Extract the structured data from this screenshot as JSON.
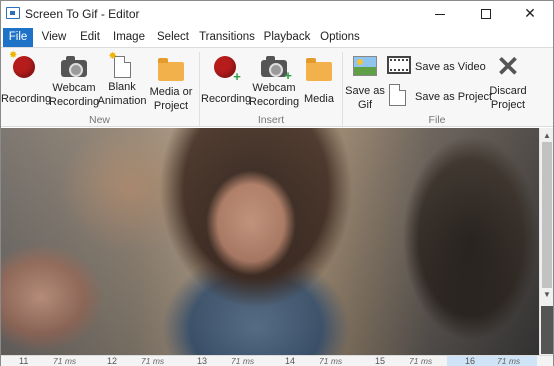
{
  "window": {
    "title": "Screen To Gif - Editor"
  },
  "tabs": [
    {
      "label": "File",
      "active": true
    },
    {
      "label": "View",
      "active": false
    },
    {
      "label": "Edit",
      "active": false
    },
    {
      "label": "Image",
      "active": false
    },
    {
      "label": "Select",
      "active": false
    },
    {
      "label": "Transitions",
      "active": false
    },
    {
      "label": "Playback",
      "active": false
    },
    {
      "label": "Options",
      "active": false
    }
  ],
  "ribbon": {
    "new": {
      "group_label": "New",
      "recording": "Recording",
      "webcam_line1": "Webcam",
      "webcam_line2": "Recording",
      "blank_line1": "Blank",
      "blank_line2": "Animation",
      "media_line1": "Media or",
      "media_line2": "Project"
    },
    "insert": {
      "group_label": "Insert",
      "recording": "Recording",
      "webcam_line1": "Webcam",
      "webcam_line2": "Recording",
      "media": "Media"
    },
    "file": {
      "group_label": "File",
      "save_gif_line1": "Save as",
      "save_gif_line2": "Gif",
      "save_video": "Save as Video",
      "save_project": "Save as Project",
      "discard_line1": "Discard",
      "discard_line2": "Project"
    }
  },
  "frames": [
    {
      "number": "11",
      "delay": "71 ms",
      "selected": false
    },
    {
      "number": "12",
      "delay": "71 ms",
      "selected": false
    },
    {
      "number": "13",
      "delay": "71 ms",
      "selected": false
    },
    {
      "number": "14",
      "delay": "71 ms",
      "selected": false
    },
    {
      "number": "15",
      "delay": "71 ms",
      "selected": false
    },
    {
      "number": "16",
      "delay": "71 ms",
      "selected": true
    }
  ],
  "colors": {
    "accent": "#1e73c8",
    "record_red": "#b71c1c",
    "selected_frame": "#cfe4f7"
  }
}
